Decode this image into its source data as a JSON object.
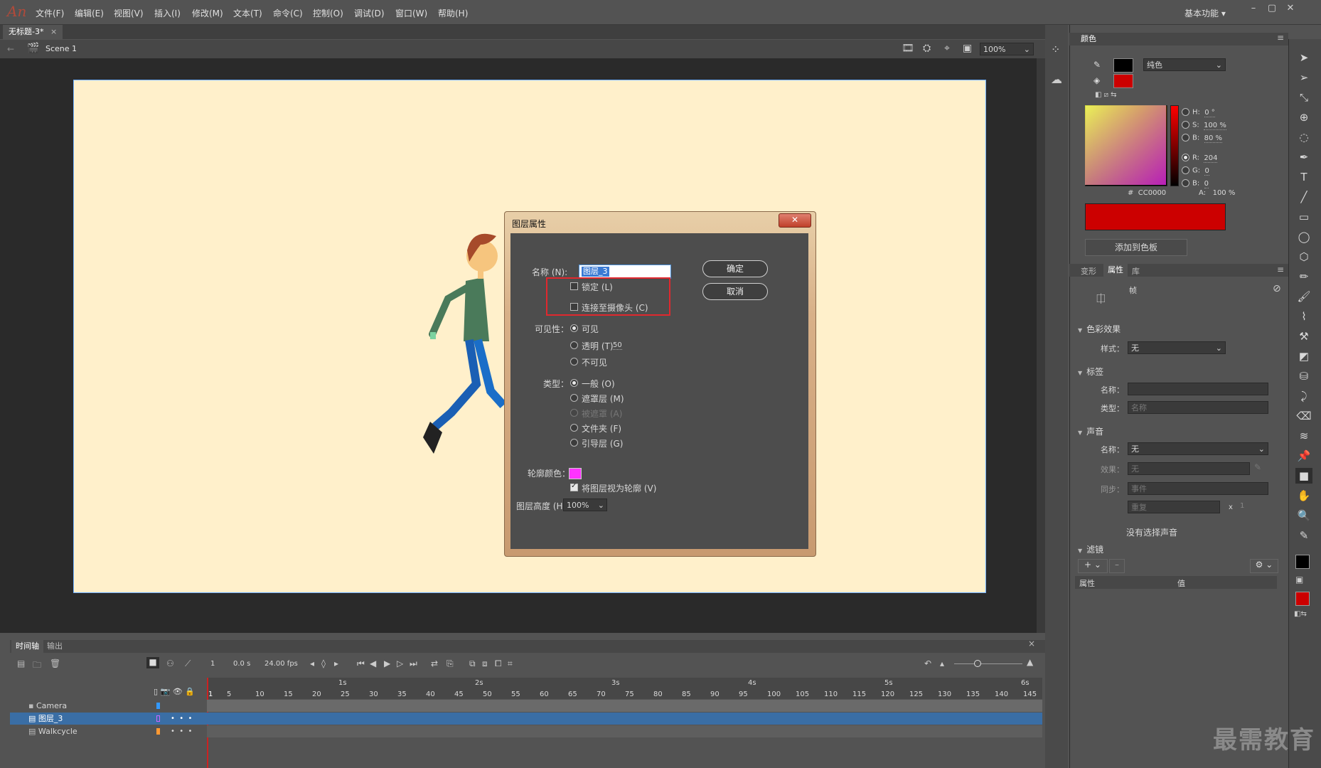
{
  "app": {
    "logo": "An",
    "workspace": "基本功能 ▾"
  },
  "menu": [
    "文件(F)",
    "编辑(E)",
    "视图(V)",
    "插入(I)",
    "修改(M)",
    "文本(T)",
    "命令(C)",
    "控制(O)",
    "调试(D)",
    "窗口(W)",
    "帮助(H)"
  ],
  "document": {
    "tab": "无标题-3*",
    "scene": "Scene 1",
    "zoom": "100%"
  },
  "dialog": {
    "title": "图层属性",
    "name_label": "名称 (N):",
    "name_value": "图层_3",
    "lock": "锁定 (L)",
    "camera": "连接至摄像头 (C)",
    "visibility_label": "可见性：",
    "visible": "可见",
    "transparent": "透明 (T)",
    "transparent_value": "50",
    "invisible": "不可见",
    "type_label": "类型：",
    "type_normal": "一般 (O)",
    "type_mask": "遮罩层 (M)",
    "type_masked": "被遮罩 (A)",
    "type_folder": "文件夹 (F)",
    "type_guide": "引导层 (G)",
    "outline_color_label": "轮廓颜色：",
    "outline_color": "#ff33ff",
    "view_outline": "将图层视为轮廓 (V)",
    "height_label": "图层高度 (H):",
    "height_value": "100%",
    "ok": "确定",
    "cancel": "取消"
  },
  "timeline": {
    "tabs": [
      "时间轴",
      "输出"
    ],
    "frame": "1",
    "time": "0.0 s",
    "fps": "24.00 fps",
    "seconds": [
      "1s",
      "2s",
      "3s",
      "4s",
      "5s",
      "6s"
    ],
    "ticks": [
      "1",
      "5",
      "10",
      "15",
      "20",
      "25",
      "30",
      "35",
      "40",
      "45",
      "50",
      "55",
      "60",
      "65",
      "70",
      "75",
      "80",
      "85",
      "90",
      "95",
      "100",
      "105",
      "110",
      "115",
      "120",
      "125",
      "130",
      "135",
      "140",
      "145"
    ],
    "layers": [
      {
        "name": "Camera",
        "color": "#3399ff"
      },
      {
        "name": "图层_3",
        "color": "#cc66ff"
      },
      {
        "name": "Walkcycle",
        "color": "#ff9933"
      }
    ]
  },
  "color_panel": {
    "title": "颜色",
    "fill_type": "纯色",
    "H": "0 °",
    "S": "100 %",
    "B": "80 %",
    "R": "204",
    "G": "0",
    "Bv": "0",
    "hex": "CC0000",
    "A": "100 %",
    "add_swatch": "添加到色板",
    "swatch_color": "#cc0000"
  },
  "properties_panel": {
    "tabs": [
      "变形",
      "属性",
      "库"
    ],
    "frame_label": "帧",
    "color_effect": "色彩效果",
    "style_label": "样式：",
    "style_value": "无",
    "label_section": "标签",
    "name_label": "名称：",
    "type_label": "类型：",
    "type_value": "名称",
    "sound_section": "声音",
    "sound_name_label": "名称：",
    "sound_name_value": "无",
    "effect_label": "效果：",
    "effect_value": "无",
    "sync_label": "同步：",
    "sync_value": "事件",
    "repeat_value": "重复",
    "repeat_x": "x",
    "repeat_count": "1",
    "no_sound": "没有选择声音",
    "filters_section": "滤镜",
    "col_prop": "属性",
    "col_value": "值"
  },
  "watermark": "最需教育"
}
